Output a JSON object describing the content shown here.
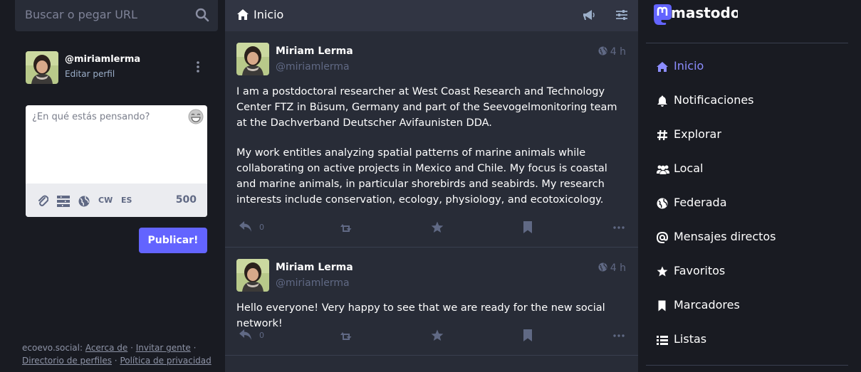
{
  "search": {
    "placeholder": "Buscar o pegar URL"
  },
  "account": {
    "handle": "@miriamlerma",
    "edit_label": "Editar perfil"
  },
  "compose": {
    "placeholder": "¿En qué estás pensando?",
    "cw_label": "CW",
    "language": "ES",
    "char_count": "500",
    "publish_label": "Publicar!"
  },
  "footer": {
    "site": "ecoevo.social",
    "links": [
      "Acerca de",
      "Invitar gente",
      "Directorio de perfiles",
      "Política de privacidad"
    ]
  },
  "column": {
    "title": "Inicio"
  },
  "statuses": [
    {
      "name": "Miriam Lerma",
      "handle": "@miriamlerma",
      "time": "4 h",
      "paragraphs": [
        "I am a postdoctoral researcher at West Coast Research and Technology Center FTZ in Büsum, Germany and part of the Seevogelmonitoring team at the Dachverband Deutscher Avifaunisten DDA.",
        "My work entitles analyzing spatial patterns of marine animals while collaborating on active projects in Mexico and Chile. My focus is coastal and marine animals, in particular shorebirds and seabirds. My research interests include conservation, ecology, physiology, and ecotoxicology."
      ],
      "replies": "0"
    },
    {
      "name": "Miriam Lerma",
      "handle": "@miriamlerma",
      "time": "4 h",
      "paragraphs": [
        "Hello everyone! Very happy to see that we are ready for the new social network!"
      ],
      "replies": "0"
    }
  ],
  "brand": {
    "name": "mastodon"
  },
  "nav": {
    "items": [
      {
        "label": "Inicio",
        "icon": "home-icon",
        "active": true
      },
      {
        "label": "Notificaciones",
        "icon": "bell-icon"
      },
      {
        "label": "Explorar",
        "icon": "hashtag-icon"
      },
      {
        "label": "Local",
        "icon": "users-icon"
      },
      {
        "label": "Federada",
        "icon": "globe-icon"
      },
      {
        "label": "Mensajes directos",
        "icon": "at-icon"
      },
      {
        "label": "Favoritos",
        "icon": "star-icon"
      },
      {
        "label": "Marcadores",
        "icon": "bookmark-icon"
      },
      {
        "label": "Listas",
        "icon": "list-icon"
      }
    ]
  },
  "colors": {
    "accent": "#6364ff",
    "active_nav": "#8c8dff",
    "bg_dark": "#191b22",
    "bg_column": "#282c37",
    "muted": "#606984"
  }
}
